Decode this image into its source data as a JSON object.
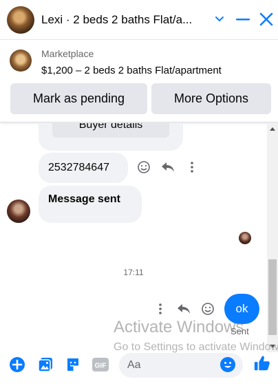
{
  "header": {
    "title": "Lexi · 2 beds 2 baths Flat/a...",
    "accent": "#0a7cff"
  },
  "marketplace": {
    "label": "Marketplace",
    "description": "$1,200 – 2 beds 2 baths Flat/apartment",
    "pending_button": "Mark as pending",
    "options_button": "More Options"
  },
  "messages": {
    "buyer_details": "Buyer details",
    "phone": "2532784647",
    "sent_text": "Message sent",
    "timestamp": "17:11",
    "ok_text": "ok",
    "status": "Sent"
  },
  "watermark": {
    "line1": "Activate Windows",
    "line2": "Go to Settings to activate Windows."
  },
  "composer": {
    "placeholder": "Aa",
    "gif_label": "GIF"
  }
}
